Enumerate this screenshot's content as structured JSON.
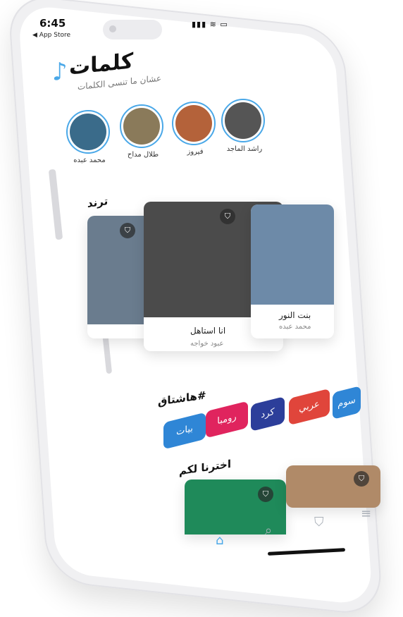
{
  "status_bar": {
    "time": "6:45",
    "back_label": "◀ App Store",
    "icons": "▮▮▮ ≋ ▭"
  },
  "header": {
    "title": "كلمات",
    "subtitle": "عشان ما تنسى الكلمات",
    "logo_icon": "music-note-icon"
  },
  "artists": [
    {
      "name": "محمد عبده",
      "color": "#3a6b8a"
    },
    {
      "name": "طلال مداح",
      "color": "#8a7a5a"
    },
    {
      "name": "فيروز",
      "color": "#b4623a"
    },
    {
      "name": "راشد الماجد",
      "color": "#555555"
    }
  ],
  "trend": {
    "title": "ترند",
    "cards": [
      {
        "title": "",
        "artist": "",
        "color": "#6a7c8e"
      },
      {
        "title": "انا استاهل",
        "artist": "عبود خواجه",
        "color": "#4b4b4b"
      },
      {
        "title": "بنت النور",
        "artist": "محمد عبده",
        "color": "#6d8aa8"
      }
    ]
  },
  "hashtags": {
    "title": "هاشتاق#",
    "chips": [
      {
        "label": "بيات",
        "color": "#2f86d6"
      },
      {
        "label": "رومبا",
        "color": "#e0245e"
      },
      {
        "label": "كرد",
        "color": "#2c3e9a"
      },
      {
        "label": "عربي",
        "color": "#e0453b"
      },
      {
        "label": "سوم",
        "color": "#2f86d6"
      }
    ]
  },
  "picks": {
    "title": "اخترنا لكم",
    "cards": [
      {
        "color": "#1f8a5a"
      },
      {
        "color": "#b08a68"
      }
    ]
  },
  "tabbar": {
    "items": [
      {
        "icon": "home-icon",
        "glyph": "⌂"
      },
      {
        "icon": "search-icon",
        "glyph": "⌕"
      },
      {
        "icon": "bookmark-icon",
        "glyph": "⛉"
      },
      {
        "icon": "menu-icon",
        "glyph": "≡"
      }
    ]
  },
  "colors": {
    "accent": "#4aa8e8"
  }
}
